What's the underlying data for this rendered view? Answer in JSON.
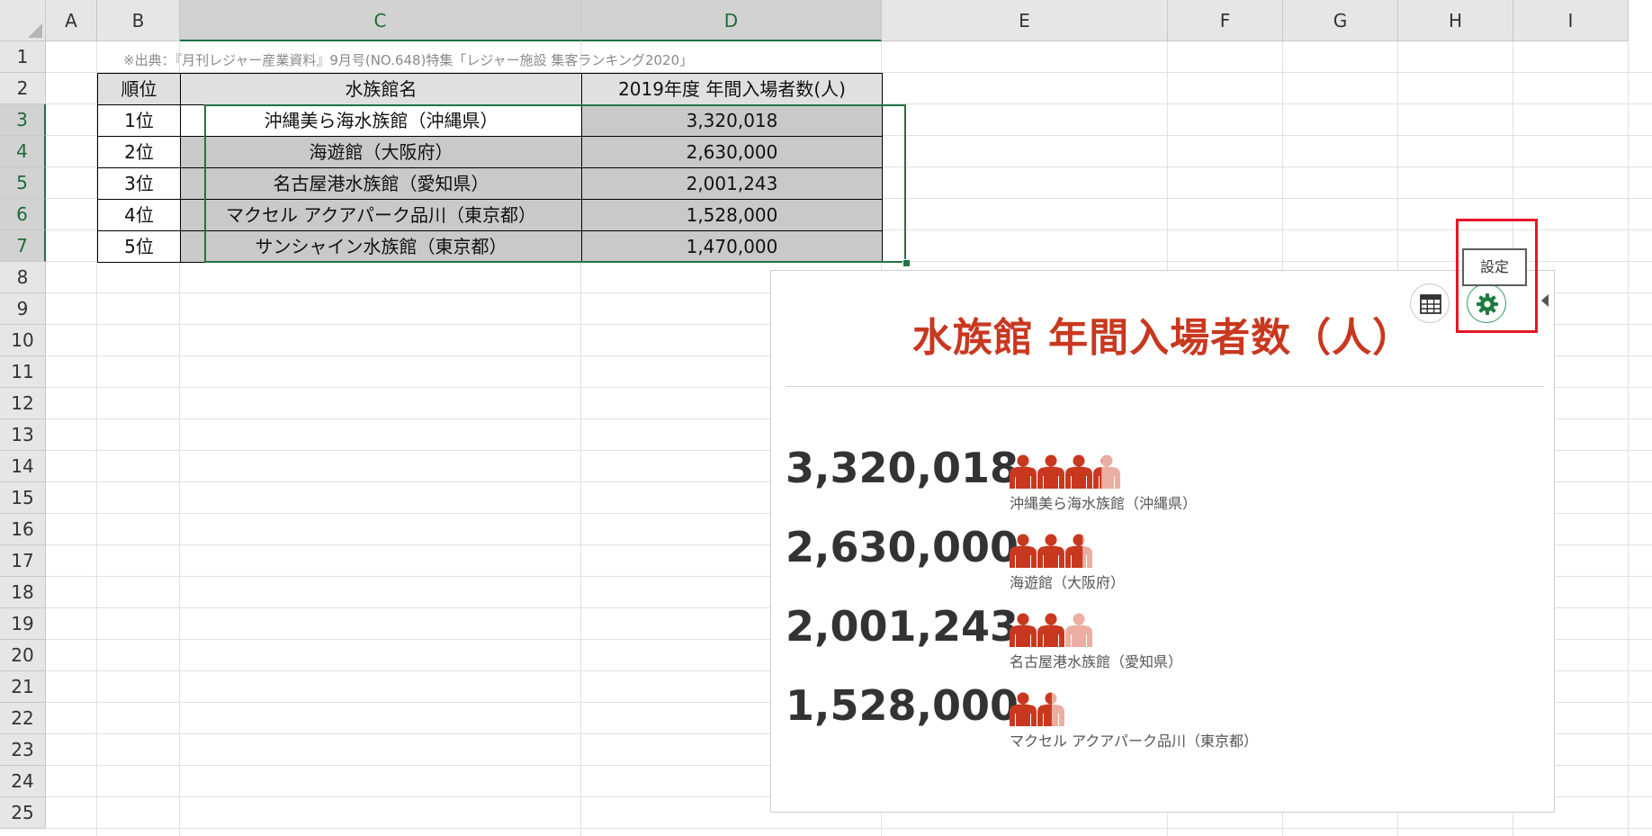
{
  "columns": [
    "A",
    "B",
    "C",
    "D",
    "E",
    "F",
    "G",
    "H",
    "I"
  ],
  "rows": [
    "1",
    "2",
    "3",
    "4",
    "5",
    "6",
    "7",
    "8",
    "9",
    "10",
    "11",
    "12",
    "13",
    "14",
    "15",
    "16",
    "17",
    "18",
    "19",
    "20",
    "21",
    "22",
    "23",
    "24",
    "25"
  ],
  "note": "※出典：『月刊レジャー産業資料』9月号(NO.648)特集「レジャー施設 集客ランキング2020」",
  "table": {
    "headers": [
      "順位",
      "水族館名",
      "2019年度 年間入場者数(人)"
    ],
    "rows": [
      {
        "rank": "1位",
        "name": "沖縄美ら海水族館（沖縄県）",
        "visitors": "3,320,018"
      },
      {
        "rank": "2位",
        "name": "海遊館（大阪府）",
        "visitors": "2,630,000"
      },
      {
        "rank": "3位",
        "name": "名古屋港水族館（愛知県）",
        "visitors": "2,001,243"
      },
      {
        "rank": "4位",
        "name": "マクセル アクアパーク品川（東京都）",
        "visitors": "1,528,000"
      },
      {
        "rank": "5位",
        "name": "サンシャイン水族館（東京都）",
        "visitors": "1,470,000"
      }
    ]
  },
  "chart": {
    "title": "水族館 年間入場者数（人）",
    "colors": {
      "icon_full": "#c8381f",
      "icon_light": "#ecaea3",
      "title": "#c8381f"
    },
    "icon_unit": 1000000,
    "items": [
      {
        "value_label": "3,320,018",
        "label": "沖縄美ら海水族館（沖縄県）",
        "value": 3320018
      },
      {
        "value_label": "2,630,000",
        "label": "海遊館（大阪府）",
        "value": 2630000
      },
      {
        "value_label": "2,001,243",
        "label": "名古屋港水族館（愛知県）",
        "value": 2001243
      },
      {
        "value_label": "1,528,000",
        "label": "マクセル アクアパーク品川（東京都）",
        "value": 1528000
      }
    ]
  },
  "toolbar": {
    "table_icon": "table-icon",
    "gear_icon": "gear-icon",
    "tooltip": "設定",
    "highlight_color": "#e51626"
  }
}
